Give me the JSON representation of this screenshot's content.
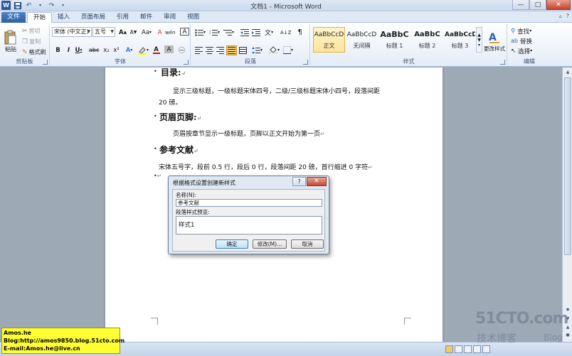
{
  "app": {
    "title": "文档1 - Microsoft Word",
    "logo_letter": "W",
    "window_buttons": {
      "minimize": "—",
      "maximize": "□",
      "close": "✕"
    }
  },
  "tabs": {
    "file": "文件",
    "items": [
      "开始",
      "插入",
      "页面布局",
      "引用",
      "邮件",
      "审阅",
      "视图"
    ],
    "active_index": 0,
    "right": {
      "collapse": "▵",
      "help": "?"
    }
  },
  "ribbon": {
    "clipboard": {
      "label": "剪贴板",
      "paste": "粘贴",
      "cut": "剪切",
      "copy": "复制",
      "format_painter": "格式刷"
    },
    "font": {
      "label": "字体",
      "font_name": "宋体 (中文正)",
      "font_size": "五号",
      "bold": "B",
      "italic": "I",
      "underline": "U",
      "strike": "abc",
      "subscript": "x₂",
      "superscript": "x²",
      "grow": "A",
      "shrink": "A",
      "change_case": "Aa",
      "clear": "A",
      "phonetic": "wén",
      "char_border": "A"
    },
    "paragraph": {
      "label": "段落"
    },
    "styles": {
      "label": "样式",
      "tiles": [
        {
          "sample": "AaBbCcD",
          "name": "正文"
        },
        {
          "sample": "AaBbCcD",
          "name": "无间隔"
        },
        {
          "sample": "AaBbC",
          "name": "标题 1"
        },
        {
          "sample": "AaBbC",
          "name": "标题 2"
        },
        {
          "sample": "AaBbCcD",
          "name": "标题 3"
        }
      ],
      "selected_index": 0,
      "change_styles": "更改样式"
    },
    "editing": {
      "label": "编辑",
      "find": "查找",
      "replace": "替换",
      "select": "选择"
    }
  },
  "document": {
    "heading_toc": "目录:",
    "toc_body_1": "显示三级标题，一级标题宋体四号，二级/三级标题宋体小四号，段落间距",
    "toc_body_2": "20 磅。",
    "heading_header": "页眉页脚:",
    "header_body": "页眉按章节显示一级标题，页脚以正文开始为第一页",
    "heading_refs": "参考文献",
    "refs_body": "宋体五号字，段前 0.5 行，段后 0 行，段落间距 20 磅，首行缩进 0 字符",
    "para_mark": "↵",
    "bullet": "•"
  },
  "dialog": {
    "title": "根据格式设置创建新样式",
    "help": "?",
    "close": "✕",
    "name_label": "名称(N):",
    "name_value": "参考文献",
    "preview_label": "段落样式预览:",
    "preview_text": "样式1",
    "ok": "确定",
    "modify": "修改(M)...",
    "cancel": "取消"
  },
  "banner": {
    "line1": "Amos.he",
    "line2": "Blog:http://amos9850.blog.51cto.com",
    "line3": "E-mail:Amos.he@live.cn"
  },
  "watermark": {
    "main": "51CTO.com",
    "sub": "技术博客",
    "blog": "Blog"
  }
}
